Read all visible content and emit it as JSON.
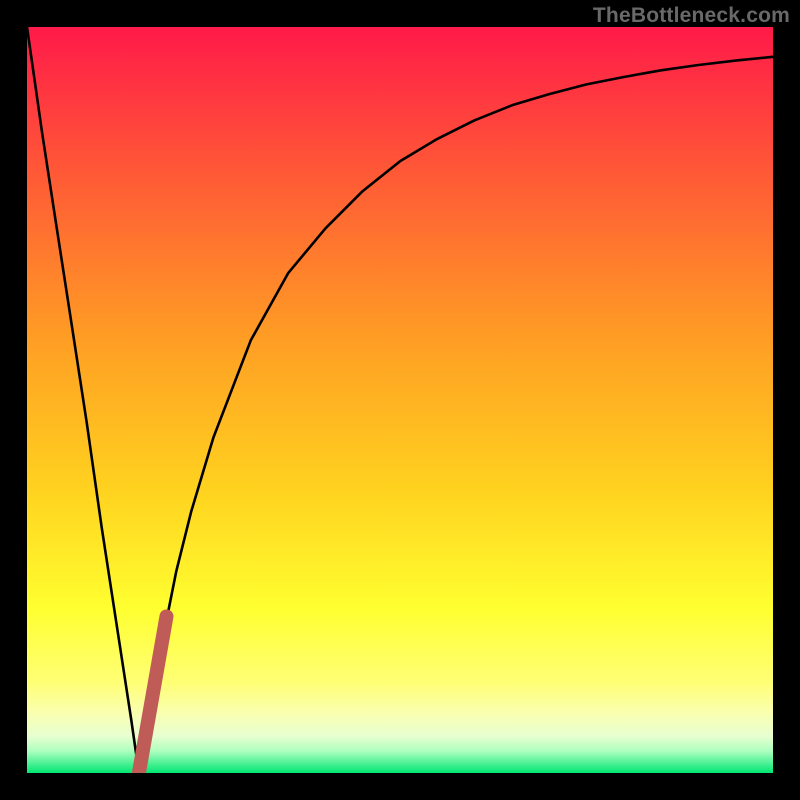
{
  "watermark": "TheBottleneck.com",
  "colors": {
    "frame": "#000000",
    "gradient_top": "#ff1a49",
    "gradient_mid1": "#ff7a2e",
    "gradient_mid2": "#ffd21f",
    "gradient_mid3": "#ffff30",
    "gradient_low": "#f8ffa0",
    "gradient_bottom": "#00e673",
    "curve": "#000000",
    "marker": "#c05c57"
  },
  "chart_data": {
    "type": "line",
    "title": "",
    "xlabel": "",
    "ylabel": "",
    "x": [
      0,
      2,
      4,
      6,
      8,
      10,
      12,
      14,
      15,
      16,
      18,
      20,
      22,
      25,
      30,
      35,
      40,
      45,
      50,
      55,
      60,
      65,
      70,
      75,
      80,
      85,
      90,
      95,
      100
    ],
    "series": [
      {
        "name": "bottleneck-curve",
        "values": [
          100,
          86,
          73,
          60,
          47,
          33,
          20,
          7,
          0,
          6,
          17,
          27,
          35,
          45,
          58,
          67,
          73,
          78,
          82,
          85,
          87.5,
          89.5,
          91,
          92.3,
          93.3,
          94.2,
          94.9,
          95.5,
          96
        ]
      }
    ],
    "xlim": [
      0,
      100
    ],
    "ylim": [
      0,
      100
    ],
    "marker": {
      "x_start": 15,
      "y_start": 0,
      "x_end": 18.7,
      "y_end": 21
    }
  }
}
